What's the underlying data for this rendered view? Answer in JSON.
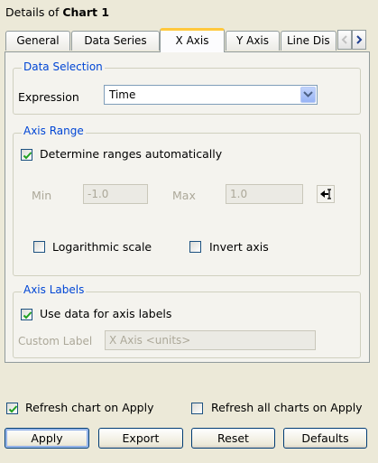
{
  "window": {
    "title_prefix": "Details of ",
    "title_chart": "Chart 1"
  },
  "tabs": [
    {
      "label": "General"
    },
    {
      "label": "Data Series"
    },
    {
      "label": "X Axis",
      "active": true
    },
    {
      "label": "Y Axis"
    },
    {
      "label": "Line Dis"
    }
  ],
  "data_selection": {
    "legend": "Data Selection",
    "expression_label": "Expression",
    "expression_value": "Time"
  },
  "axis_range": {
    "legend": "Axis Range",
    "auto_label": "Determine ranges automatically",
    "auto_checked": true,
    "min_label": "Min",
    "min_value": "-1.0",
    "max_label": "Max",
    "max_value": "1.0",
    "log_label": "Logarithmic scale",
    "invert_label": "Invert axis"
  },
  "axis_labels": {
    "legend": "Axis Labels",
    "use_data_label": "Use data for axis labels",
    "use_data_checked": true,
    "custom_label": "Custom Label",
    "custom_value": "X Axis <units>"
  },
  "footer": {
    "refresh_chart_label": "Refresh chart on Apply",
    "refresh_chart_checked": true,
    "refresh_all_label": "Refresh all charts on Apply",
    "refresh_all_checked": false
  },
  "buttons": {
    "apply": "Apply",
    "export": "Export",
    "reset": "Reset",
    "defaults": "Defaults"
  },
  "colors": {
    "accent": "#0046d5",
    "active_tab_highlight": "#ffc83c",
    "background": "#ece9d8"
  },
  "icons": {
    "scroll_left": "chevron-left-icon",
    "scroll_right": "chevron-right-icon",
    "range_tool": "range-arrow-icon"
  }
}
